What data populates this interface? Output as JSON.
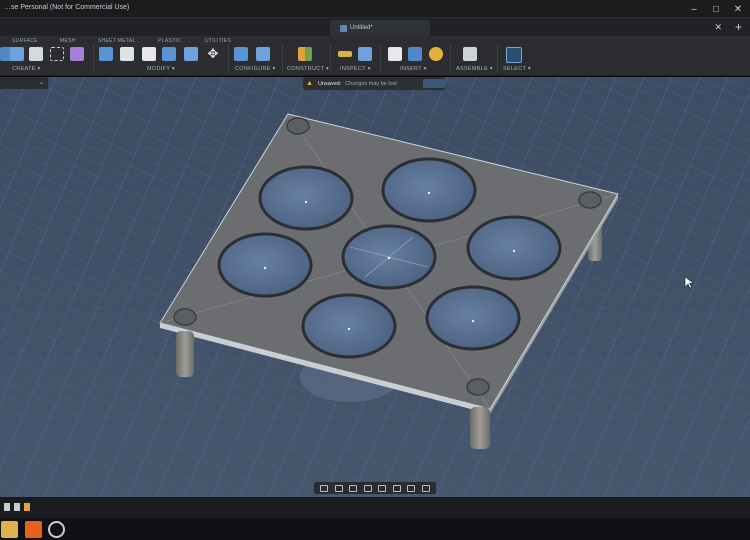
{
  "window": {
    "title": "…se Personal (Not for Commercial Use)",
    "minimize_icon": "minimize-icon",
    "maximize_icon": "maximize-icon",
    "close_icon": "close-icon"
  },
  "document_tab": {
    "label": "Untitled*",
    "close_glyph": "✕",
    "add_glyph": "+"
  },
  "ribbon": {
    "tabs": [
      "SURFACE",
      "MESH",
      "SHEET METAL",
      "PLASTIC",
      "UTILITIES"
    ],
    "groups": {
      "create": "CREATE ▾",
      "modify": "MODIFY ▾",
      "configure": "CONFIGURE ▾",
      "construct": "CONSTRUCT ▾",
      "inspect": "INSPECT ▾",
      "insert": "INSERT ▾",
      "assemble": "ASSEMBLE ▾",
      "select": "SELECT ▾"
    }
  },
  "notice": {
    "title": "Unsaved:",
    "message": "Changes may be lost"
  },
  "colors": {
    "grid_bg": "#3b4c63",
    "grid_line": "#56688a",
    "plate": "#6b6d70",
    "plate_edge": "#cdd2d8",
    "hole_fill": "#5a7393",
    "leg": "#8a8b86",
    "accent": "#f2b233"
  }
}
